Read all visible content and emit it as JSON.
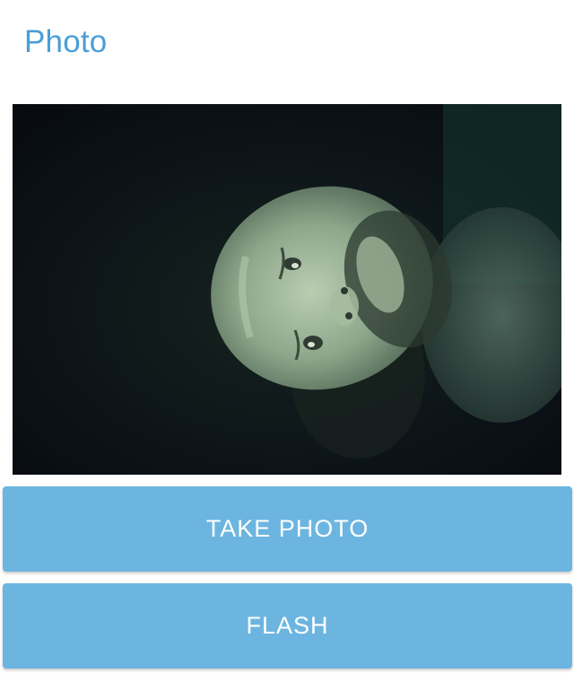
{
  "header": {
    "title": "Photo"
  },
  "camera": {
    "preview_name": "camera-preview"
  },
  "actions": {
    "take_photo_label": "TAKE PHOTO",
    "flash_label": "FLASH"
  },
  "colors": {
    "title": "#4a9fd6",
    "button_bg": "#6cb5e0",
    "button_text": "#ffffff"
  }
}
